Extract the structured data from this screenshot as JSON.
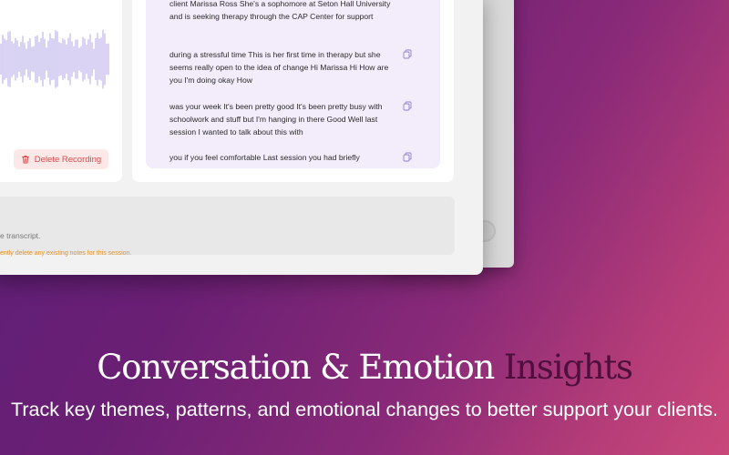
{
  "recording": {
    "delete_label": "Delete Recording"
  },
  "transcript": {
    "segments": [
      {
        "text": "client Marissa Ross She's a sophomore at Seton Hall University and is seeking therapy through the CAP Center for support"
      },
      {
        "text": "during a stressful time This is her first time in therapy but she seems really open to the idea of change Hi Marissa Hi How are you I'm doing okay How"
      },
      {
        "text": "was your week It's been pretty good It's been pretty busy with schoolwork and stuff but I'm hanging in there Good Well last session I wanted to talk about this with"
      },
      {
        "text": "you if you feel comfortable Last session you had briefly"
      }
    ]
  },
  "notes": {
    "info_text": "e transcript.",
    "warning_text": "ently delete any existing notes for this session."
  },
  "marketing": {
    "headline_main": "Conversation & Emotion",
    "headline_accent": "Insights",
    "subheadline": "Track key themes, patterns, and emotional changes to better support your clients."
  },
  "colors": {
    "waveform": "#c9c0ee",
    "delete_text": "#e04848",
    "transcript_bg": "#f3ecfb",
    "accent_word": "#4e0f3d",
    "warning": "#e3962a"
  }
}
